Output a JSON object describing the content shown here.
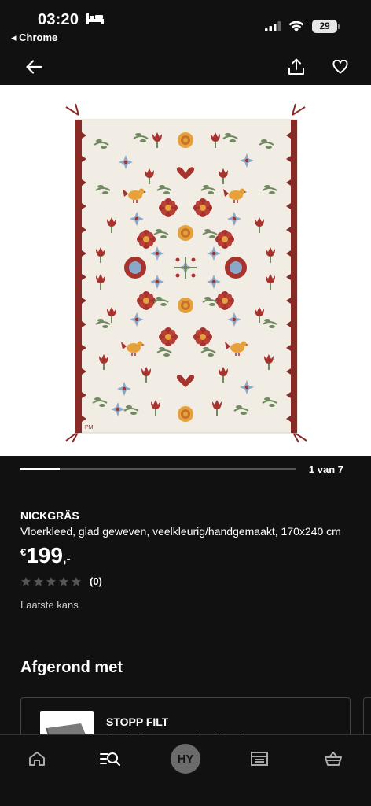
{
  "status_bar": {
    "time": "03:20",
    "back_app": "◂ Chrome",
    "battery": "29"
  },
  "product": {
    "brand": "NICKGRÄS",
    "description": "Vloerkleed, glad geweven, veelkleurig/handgemaakt, 170x240 cm",
    "price_currency": "€",
    "price_integer": "199",
    "price_decimal": ",-",
    "rating_stars": 0,
    "review_count": "(0)",
    "status": "Laatste kans"
  },
  "carousel": {
    "counter": "1 van 7",
    "current": 1,
    "total": 7
  },
  "rug": {
    "initials": "PM"
  },
  "section": {
    "title": "Afgerond met"
  },
  "recommendation": {
    "name": "STOPP FILT",
    "subtitle": "Onderlaag voor vloerkleed"
  },
  "bottom_nav": {
    "avatar_initials": "HY",
    "items": [
      "home-icon",
      "search-icon",
      "profile-avatar",
      "store-icon",
      "cart-icon"
    ]
  },
  "colors": {
    "background": "#111111",
    "rug_base": "#f1ede4",
    "rug_red": "#a8322d",
    "rug_border": "#8a2a26"
  }
}
